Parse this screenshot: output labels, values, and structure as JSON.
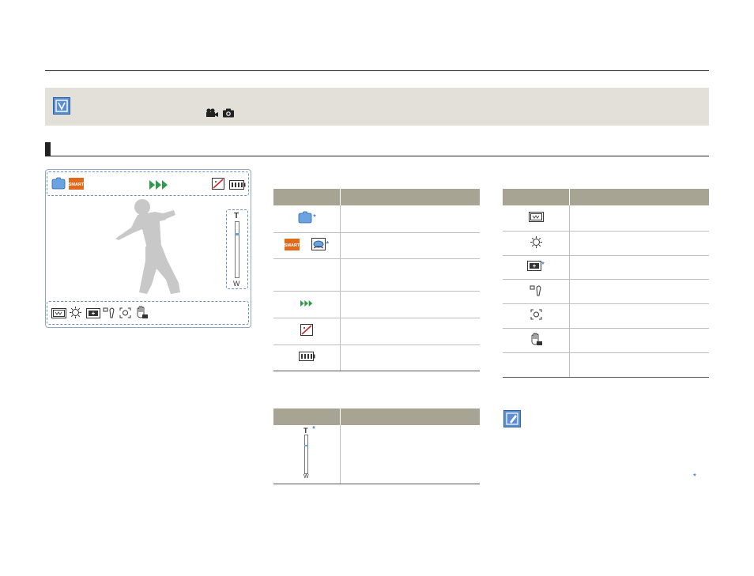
{
  "info_banner": {
    "mode_icons": [
      "video-camera-icon",
      "photo-camera-icon"
    ]
  },
  "lcd": {
    "top_icons": [
      "scene-mode-icon",
      "smart-auto-icon",
      "fast-forward-icon",
      "card-status-icon",
      "battery-icon"
    ],
    "bottom_icons": [
      "white-balance-icon",
      "exposure-icon",
      "backlight-icon",
      "focus-icon",
      "anti-shake-icon",
      "hand-shake-icon"
    ],
    "zoom": {
      "top_label": "T",
      "bottom_label": "W",
      "level": 0.25
    }
  },
  "table_top_left": {
    "rows": [
      {
        "icon": "scene-mode-icon",
        "star": "*"
      },
      {
        "icon": "smart-auto-underwater-icon",
        "star": "*"
      },
      {
        "icon": ""
      },
      {
        "icon": "fast-forward-icon"
      },
      {
        "icon": "card-status-icon"
      },
      {
        "icon": "battery-icon"
      }
    ]
  },
  "table_bottom_left": {
    "zoom": {
      "top_label": "T",
      "bottom_label": "W",
      "star": "*",
      "level": 0.25
    }
  },
  "table_right": {
    "rows": [
      {
        "icon": "white-balance-icon"
      },
      {
        "icon": "exposure-icon"
      },
      {
        "icon": "backlight-icon",
        "star": "*"
      },
      {
        "icon": "focus-icon"
      },
      {
        "icon": "anti-shake-icon"
      },
      {
        "icon": "hand-shake-icon"
      },
      {
        "icon": ""
      }
    ]
  },
  "note": {
    "star": "*"
  },
  "colors": {
    "accent_blue": "#5b8fcf",
    "banner_bg": "#e2e0d8",
    "table_header": "#a8a493",
    "smart_orange": "#e06a1c",
    "ff_green": "#2f9a4a"
  }
}
